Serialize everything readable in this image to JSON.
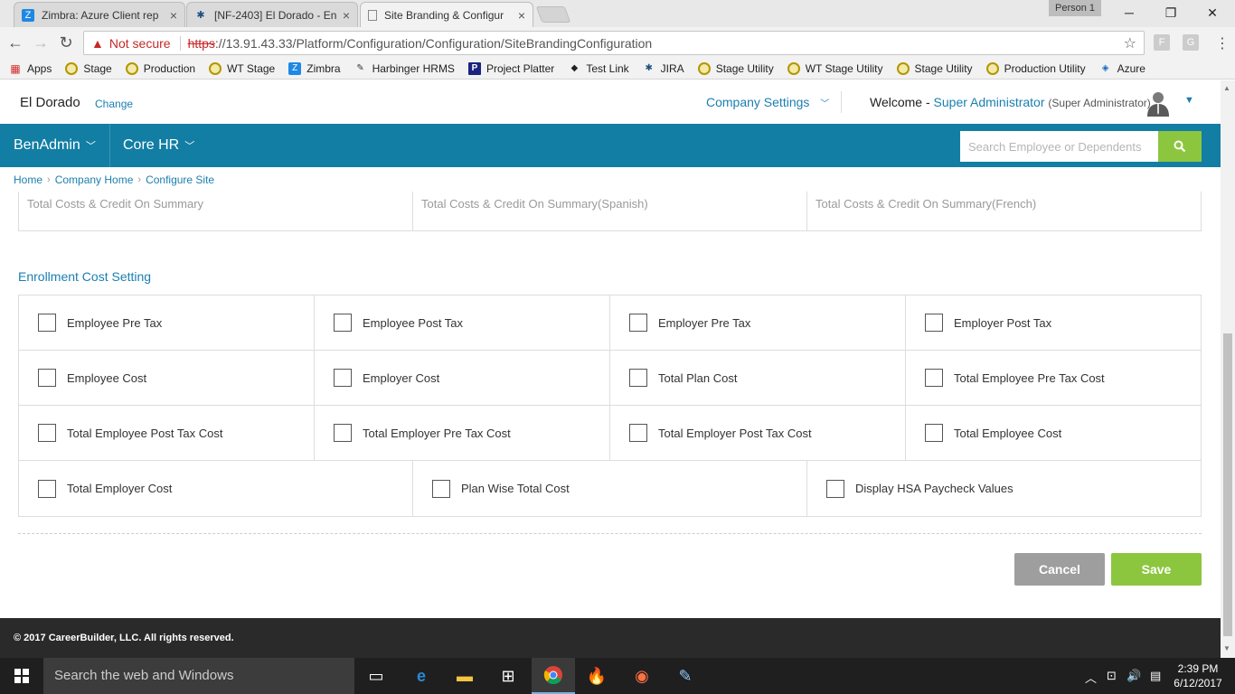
{
  "browser": {
    "tabs": [
      {
        "label": "Zimbra: Azure Client rep",
        "close": "×"
      },
      {
        "label": "[NF-2403] El Dorado - En",
        "close": "×"
      },
      {
        "label": "Site Branding & Configur",
        "close": "×"
      }
    ],
    "person": "Person 1",
    "address": {
      "not_secure": "Not secure",
      "scheme": "https",
      "rest": "://13.91.43.33/Platform/Configuration/Configuration/SiteBrandingConfiguration"
    },
    "bookmarks": [
      {
        "label": "Apps",
        "icon": "apps-grid-icon"
      },
      {
        "label": "Stage",
        "icon": "globe-icon"
      },
      {
        "label": "Production",
        "icon": "globe-icon"
      },
      {
        "label": "WT Stage",
        "icon": "globe-icon"
      },
      {
        "label": "Zimbra",
        "icon": "zimbra-icon"
      },
      {
        "label": "Harbinger HRMS",
        "icon": "hrms-icon"
      },
      {
        "label": "Project Platter",
        "icon": "p-icon"
      },
      {
        "label": "Test Link",
        "icon": "testlink-icon"
      },
      {
        "label": "JIRA",
        "icon": "jira-icon"
      },
      {
        "label": "Stage Utility",
        "icon": "globe-icon"
      },
      {
        "label": "WT Stage Utility",
        "icon": "globe-icon"
      },
      {
        "label": "Stage Utility",
        "icon": "globe-icon"
      },
      {
        "label": "Production Utility",
        "icon": "globe-icon"
      },
      {
        "label": "Azure",
        "icon": "azure-icon"
      }
    ]
  },
  "header": {
    "company": "El Dorado",
    "change": "Change",
    "company_settings": "Company Settings",
    "welcome": "Welcome - ",
    "user_name": "Super Administrator",
    "user_role": "(Super Administrator)"
  },
  "nav": {
    "items": [
      {
        "label": "BenAdmin"
      },
      {
        "label": "Core HR"
      }
    ],
    "search_placeholder": "Search Employee or Dependents"
  },
  "breadcrumb": [
    "Home",
    "Company Home",
    "Configure Site"
  ],
  "totals_row": [
    "Total Costs & Credit On Summary",
    "Total Costs & Credit On Summary(Spanish)",
    "Total Costs & Credit On Summary(French)"
  ],
  "enrollment": {
    "title": "Enrollment Cost Setting",
    "rows": [
      [
        {
          "label": "Employee Pre Tax",
          "checked": false
        },
        {
          "label": "Employee Post Tax",
          "checked": false
        },
        {
          "label": "Employer Pre Tax",
          "checked": false
        },
        {
          "label": "Employer Post Tax",
          "checked": false
        }
      ],
      [
        {
          "label": "Employee Cost",
          "checked": false
        },
        {
          "label": "Employer Cost",
          "checked": false
        },
        {
          "label": "Total Plan Cost",
          "checked": false
        },
        {
          "label": "Total Employee Pre Tax Cost",
          "checked": false
        }
      ],
      [
        {
          "label": "Total Employee Post Tax Cost",
          "checked": false
        },
        {
          "label": "Total Employer Pre Tax Cost",
          "checked": false
        },
        {
          "label": "Total Employer Post Tax Cost",
          "checked": false
        },
        {
          "label": "Total Employee Cost",
          "checked": false
        }
      ],
      [
        {
          "label": "Total Employer Cost",
          "checked": false
        },
        {
          "label": "Plan Wise Total Cost",
          "checked": false
        },
        {
          "label": "Display HSA Paycheck Values",
          "checked": false
        }
      ]
    ]
  },
  "actions": {
    "cancel": "Cancel",
    "save": "Save"
  },
  "footer": "© 2017 CareerBuilder, LLC. All rights reserved.",
  "taskbar": {
    "search": "Search the web and Windows",
    "time": "2:39 PM",
    "date": "6/12/2017"
  },
  "colors": {
    "nav_bar": "#127ea3",
    "accent_green": "#8cc63f",
    "link_blue": "#1a7fb0",
    "cancel_gray": "#9e9e9e"
  }
}
